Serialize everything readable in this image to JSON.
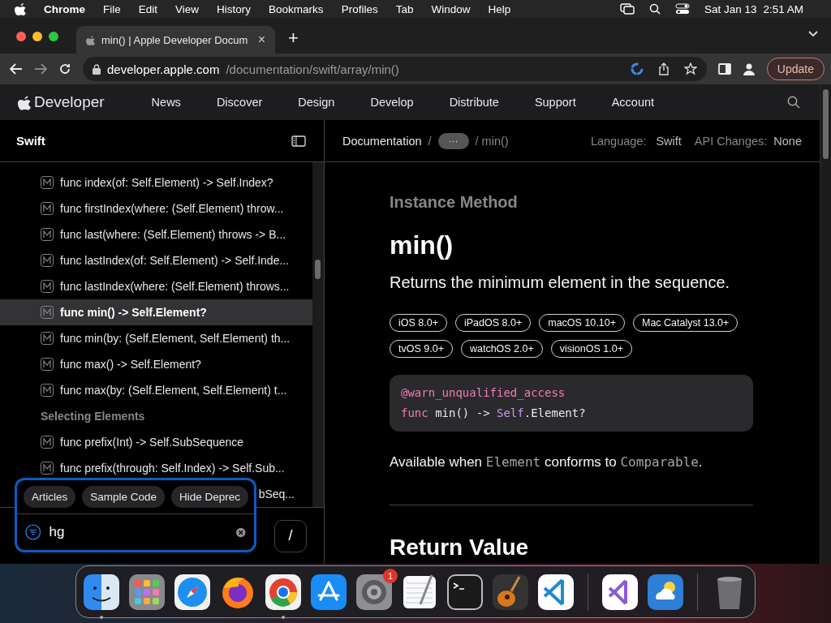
{
  "menu_bar": {
    "app": "Chrome",
    "items": [
      "File",
      "Edit",
      "View",
      "History",
      "Bookmarks",
      "Profiles",
      "Tab",
      "Window",
      "Help"
    ],
    "date": "Sat Jan 13",
    "time": "2:51 AM"
  },
  "browser": {
    "tab": {
      "title": "min() | Apple Developer Docum",
      "close": "×",
      "selected": true
    },
    "new_tab": "+",
    "url_host": "developer.apple.com",
    "url_path": "/documentation/swift/array/min()",
    "update_button": "Update"
  },
  "site_nav": {
    "brand": "Developer",
    "items": [
      "News",
      "Discover",
      "Design",
      "Develop",
      "Distribute",
      "Support",
      "Account"
    ]
  },
  "sidebar": {
    "title": "Swift",
    "items": [
      {
        "kind": "method",
        "label": "func index(of: Self.Element) -> Self.Index?",
        "selected": false
      },
      {
        "kind": "method",
        "label": "func firstIndex(where: (Self.Element) throw...",
        "selected": false
      },
      {
        "kind": "method",
        "label": "func last(where: (Self.Element) throws -> B...",
        "selected": false
      },
      {
        "kind": "method",
        "label": "func lastIndex(of: Self.Element) -> Self.Inde...",
        "selected": false
      },
      {
        "kind": "method",
        "label": "func lastIndex(where: (Self.Element) throws...",
        "selected": false
      },
      {
        "kind": "method",
        "label": "func min() -> Self.Element?",
        "selected": true
      },
      {
        "kind": "method",
        "label": "func min(by: (Self.Element, Self.Element) th...",
        "selected": false
      },
      {
        "kind": "method",
        "label": "func max() -> Self.Element?",
        "selected": false
      },
      {
        "kind": "method",
        "label": "func max(by: (Self.Element, Self.Element) t...",
        "selected": false
      },
      {
        "kind": "heading",
        "label": "Selecting Elements"
      },
      {
        "kind": "method",
        "label": "func prefix(Int) -> Self.SubSequence",
        "selected": false
      },
      {
        "kind": "method",
        "label": "func prefix(through: Self.Index) -> Self.Sub...",
        "selected": false
      },
      {
        "kind": "partial",
        "label": "bSeq...",
        "selected": false
      }
    ],
    "filter": {
      "chips": [
        "Articles",
        "Sample Code",
        "Hide Deprec"
      ],
      "value": "hg",
      "shortcut": "/"
    }
  },
  "doc": {
    "breadcrumb": {
      "root": "Documentation",
      "separator": "/",
      "more": "···",
      "current": "/ min()"
    },
    "language_label": "Language:",
    "language": "Swift",
    "api_label": "API Changes:",
    "api": "None",
    "eyebrow": "Instance Method",
    "title": "min()",
    "abstract": "Returns the minimum element in the sequence.",
    "platforms": [
      [
        "iOS 8.0+",
        "iPadOS 8.0+",
        "macOS 10.10+",
        "Mac Catalyst 13.0+"
      ],
      [
        "tvOS 9.0+",
        "watchOS 2.0+",
        "visionOS 1.0+"
      ]
    ],
    "declaration": [
      [
        {
          "kind": "attribute",
          "text": "@warn_unqualified_access"
        }
      ],
      [
        {
          "kind": "keyword",
          "text": "func"
        },
        {
          "kind": "plain",
          "text": " min() -> "
        },
        {
          "kind": "type",
          "text": "Self"
        },
        {
          "kind": "plain",
          "text": ".Element?"
        }
      ]
    ],
    "availability": [
      {
        "kind": "text",
        "text": "Available when "
      },
      {
        "kind": "code",
        "text": "Element"
      },
      {
        "kind": "text",
        "text": " conforms to "
      },
      {
        "kind": "code",
        "text": "Comparable"
      },
      {
        "kind": "text",
        "text": "."
      }
    ],
    "section_title": "Return Value"
  },
  "dock": [
    {
      "kind": "finder",
      "running": true
    },
    {
      "kind": "launchpad",
      "running": false
    },
    {
      "kind": "safari",
      "running": false
    },
    {
      "kind": "firefox",
      "running": false
    },
    {
      "kind": "chrome",
      "running": true
    },
    {
      "kind": "appstore",
      "running": false
    },
    {
      "kind": "settings",
      "running": false,
      "badge": "1"
    },
    {
      "kind": "textedit",
      "running": false
    },
    {
      "kind": "terminal",
      "running": false
    },
    {
      "kind": "garageband",
      "running": false
    },
    {
      "kind": "vscode",
      "running": false
    },
    {
      "kind": "separator"
    },
    {
      "kind": "visualstudio",
      "running": false
    },
    {
      "kind": "weather",
      "running": false
    },
    {
      "kind": "separator"
    },
    {
      "kind": "trash",
      "running": false
    }
  ]
}
